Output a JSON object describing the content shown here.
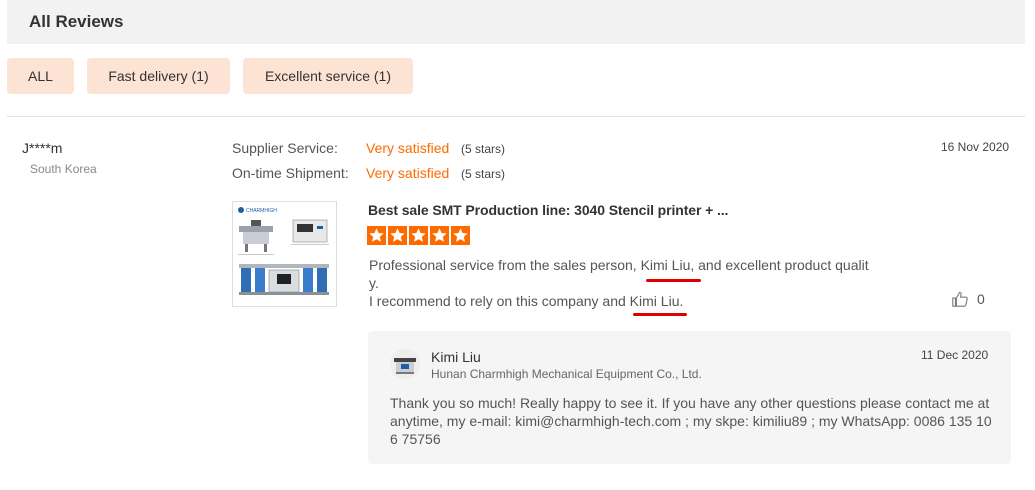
{
  "header": {
    "title": "All Reviews"
  },
  "filters": [
    {
      "label": "ALL"
    },
    {
      "label": "Fast delivery (1)"
    },
    {
      "label": "Excellent service (1)"
    }
  ],
  "review": {
    "reviewer_name": "J****m",
    "country": "South Korea",
    "date": "16 Nov 2020",
    "ratings": [
      {
        "label": "Supplier Service:",
        "value": "Very satisfied",
        "stars_text": "(5 stars)"
      },
      {
        "label": "On-time Shipment:",
        "value": "Very satisfied",
        "stars_text": "(5 stars)"
      }
    ],
    "product_title": "Best sale SMT Production line: 3040 Stencil printer + ...",
    "star_count": 5,
    "star_color": "#ff6a00",
    "text_line1": "Professional service from the sales person, Kimi Liu, and excellent product qualit",
    "text_line2": "y.",
    "text_line3": "I recommend to rely on this company and Kimi Liu.",
    "likes": "0",
    "thumb_logo": "CHARMHIGH"
  },
  "reply": {
    "name": "Kimi Liu",
    "company": "Hunan Charmhigh Mechanical Equipment Co., Ltd.",
    "date": "11 Dec 2020",
    "text": "Thank you so much! Really happy to see it. If you have any other questions please contact me at anytime, my e-mail:  kimi@charmhigh-tech.com ; my skpe: kimiliu89 ; my WhatsApp: 0086 135 106 75756"
  },
  "colors": {
    "accent": "#ff6a00",
    "filter_bg": "#fde3d3",
    "underline": "#e00000"
  }
}
